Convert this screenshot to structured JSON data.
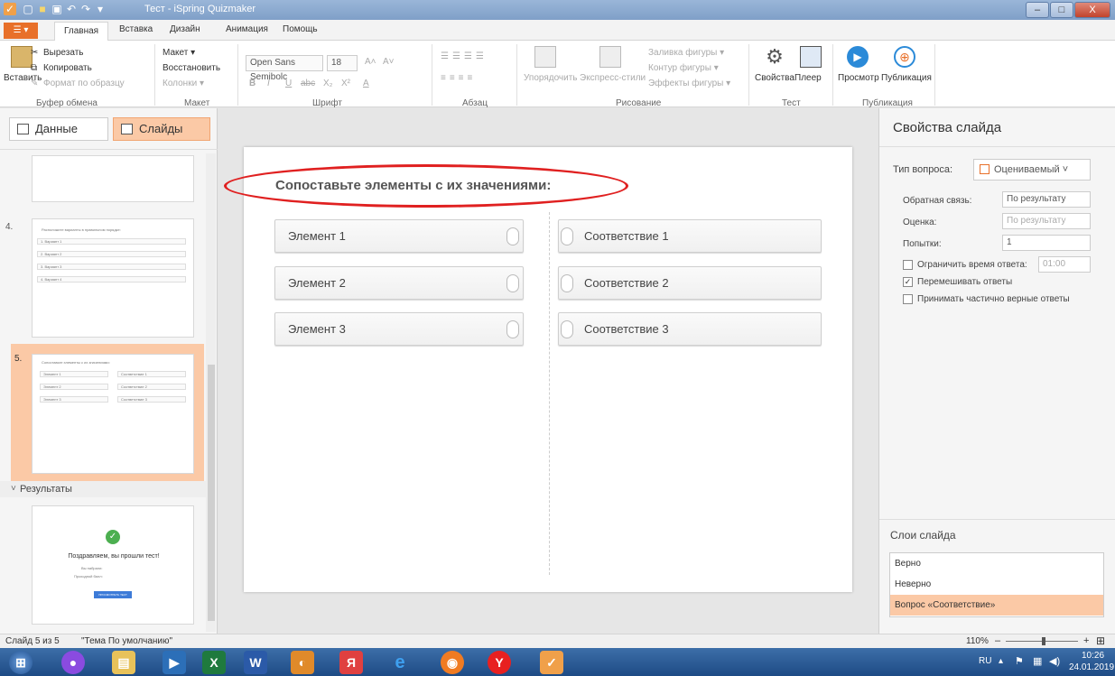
{
  "window": {
    "title": "Тест - iSpring Quizmaker",
    "min": "–",
    "max": "□",
    "close": "X"
  },
  "menu": {
    "file": "☰ ▾",
    "tabs": [
      "Главная",
      "Вставка",
      "Дизайн",
      "Анимация",
      "Помощь"
    ]
  },
  "ribbon": {
    "clipboard": {
      "paste": "Вставить",
      "cut": "Вырезать",
      "copy": "Копировать",
      "format": "Формат по образцу",
      "label": "Буфер обмена"
    },
    "layout": {
      "layout": "Макет ▾",
      "restore": "Восстановить",
      "columns": "Колонки ▾",
      "label": "Макет"
    },
    "font": {
      "family": "Open Sans Semibolc",
      "size": "18",
      "bold": "B",
      "italic": "I",
      "underline": "U",
      "strike": "abc",
      "sub": "X₂",
      "sup": "X²",
      "color": "A",
      "grow": "A˄",
      "shrink": "A˅",
      "label": "Шрифт"
    },
    "paragraph": {
      "label": "Абзац"
    },
    "drawing": {
      "arrange": "Упорядочить",
      "styles": "Экспресс-стили",
      "fill": "Заливка фигуры ▾",
      "outline": "Контур фигуры ▾",
      "effects": "Эффекты фигуры ▾",
      "label": "Рисование"
    },
    "test": {
      "properties": "Свойства",
      "player": "Плеер",
      "label": "Тест"
    },
    "publish": {
      "preview": "Просмотр",
      "publish": "Публикация",
      "label": "Публикация"
    }
  },
  "left": {
    "tabs": {
      "data": "Данные",
      "slides": "Слайды"
    },
    "slide4": {
      "num": "4.",
      "title": "Расположите варианты в правильном порядке:",
      "items": [
        "1.  Вариант 1",
        "2.  Вариант 2",
        "3.  Вариант 3",
        "4.  Вариант 4"
      ]
    },
    "slide5": {
      "num": "5.",
      "title": "Сопоставьте элементы с их значениями:",
      "left": [
        "Элемент 1",
        "Элемент 2",
        "Элемент 3"
      ],
      "right": [
        "Соответствие 1",
        "Соответствие 2",
        "Соответствие 3"
      ]
    },
    "results": {
      "header": "Результаты",
      "congrats": "Поздравляем, вы прошли тест!",
      "scored": "Вы набрали:",
      "passing": "Проходной балл:",
      "button": "ПРОСМОТРЕТЬ ТЕСТ"
    }
  },
  "slide": {
    "question": "Сопоставьте элементы с их значениями:",
    "left": [
      "Элемент 1",
      "Элемент 2",
      "Элемент 3"
    ],
    "right": [
      "Соответствие 1",
      "Соответствие 2",
      "Соответствие 3"
    ]
  },
  "props": {
    "header": "Свойства слайда",
    "type_label": "Тип вопроса:",
    "type_value": "Оцениваемый ˅",
    "feedback_label": "Обратная связь:",
    "feedback_value": "По результату",
    "score_label": "Оценка:",
    "score_value": "По результату",
    "attempts_label": "Попытки:",
    "attempts_value": "1",
    "limit_label": "Ограничить время ответа:",
    "limit_value": "01:00",
    "shuffle_label": "Перемешивать ответы",
    "partial_label": "Принимать частично верные ответы",
    "layers_header": "Слои слайда",
    "layers": [
      "Верно",
      "Неверно",
      "Вопрос «Соответствие»"
    ]
  },
  "status": {
    "slide": "Слайд 5 из 5",
    "theme": "\"Тема По умолчанию\"",
    "zoom": "110%",
    "minus": "–",
    "plus": "+"
  },
  "taskbar": {
    "lang": "RU",
    "time": "10:26",
    "date": "24.01.2019"
  },
  "colors": {
    "accent": "#f3a570",
    "annotation": "#e02020"
  }
}
